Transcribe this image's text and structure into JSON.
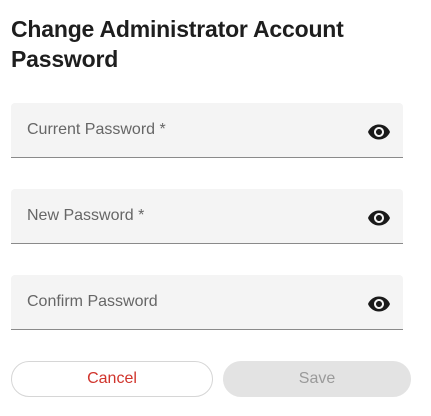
{
  "dialog": {
    "title": "Change Administrator Account Password"
  },
  "fields": [
    {
      "placeholder": "Current Password *",
      "value": "",
      "icon": "eye-icon"
    },
    {
      "placeholder": "New Password *",
      "value": "",
      "icon": "eye-icon"
    },
    {
      "placeholder": "Confirm Password",
      "value": "",
      "icon": "eye-icon"
    }
  ],
  "actions": {
    "cancel_label": "Cancel",
    "save_label": "Save"
  },
  "colors": {
    "cancel_text": "#d0342c",
    "save_disabled_bg": "#e3e3e3",
    "save_disabled_text": "#9a9a9a",
    "field_bg": "#f4f4f4"
  }
}
